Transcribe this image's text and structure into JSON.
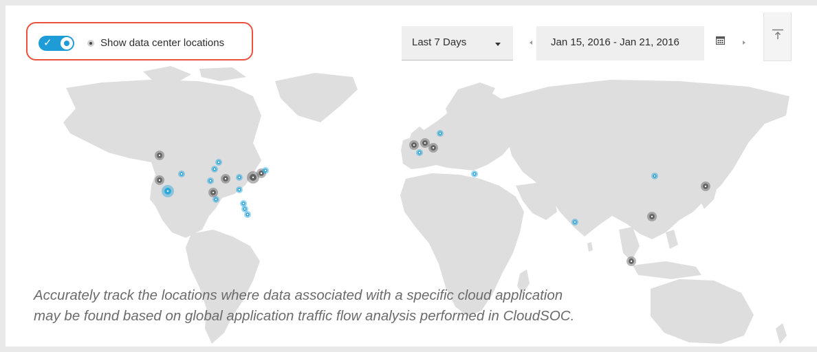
{
  "toolbar": {
    "toggle": {
      "checked": true,
      "check_glyph": "✓",
      "color": "#1e9cd7"
    },
    "legend_label": "Show data center locations",
    "range_select": {
      "selected": "Last 7 Days"
    },
    "date_range": "Jan 15, 2016 - Jan 21, 2016",
    "icons": {
      "prev": "chevron-left-icon",
      "next": "chevron-right-icon",
      "calendar": "calendar-icon",
      "scroll_top": "arrow-up-to-line-icon"
    }
  },
  "map": {
    "land_color": "#dedede",
    "marker_colors": {
      "traffic": "#29a5da",
      "data_center": "#5e5e5e"
    },
    "markers": [
      {
        "region": "Pacific Northwest",
        "type": "data_center",
        "size": "m"
      },
      {
        "region": "Northern California",
        "type": "data_center",
        "size": "m"
      },
      {
        "region": "Southern California",
        "type": "traffic",
        "size": "l"
      },
      {
        "region": "Utah",
        "type": "traffic",
        "size": "s"
      },
      {
        "region": "Great Plains",
        "type": "traffic",
        "size": "s"
      },
      {
        "region": "Great Plains",
        "type": "traffic",
        "size": "s"
      },
      {
        "region": "Midwest",
        "type": "data_center",
        "size": "m"
      },
      {
        "region": "Midwest",
        "type": "traffic",
        "size": "s"
      },
      {
        "region": "Texas",
        "type": "data_center",
        "size": "m"
      },
      {
        "region": "Texas",
        "type": "traffic",
        "size": "s"
      },
      {
        "region": "Ohio Valley",
        "type": "traffic",
        "size": "s"
      },
      {
        "region": "Ohio Valley",
        "type": "traffic",
        "size": "s"
      },
      {
        "region": "Virginia",
        "type": "data_center",
        "size": "l"
      },
      {
        "region": "Northeast",
        "type": "data_center",
        "size": "m"
      },
      {
        "region": "Northeast",
        "type": "traffic",
        "size": "s"
      },
      {
        "region": "Southeast",
        "type": "traffic",
        "size": "s"
      },
      {
        "region": "Florida",
        "type": "traffic",
        "size": "s"
      },
      {
        "region": "Florida",
        "type": "traffic",
        "size": "s"
      },
      {
        "region": "Ireland",
        "type": "data_center",
        "size": "m"
      },
      {
        "region": "United Kingdom",
        "type": "data_center",
        "size": "m"
      },
      {
        "region": "Germany",
        "type": "data_center",
        "size": "m"
      },
      {
        "region": "France",
        "type": "traffic",
        "size": "s"
      },
      {
        "region": "Scandinavia",
        "type": "traffic",
        "size": "s"
      },
      {
        "region": "Turkey",
        "type": "traffic",
        "size": "s"
      },
      {
        "region": "India",
        "type": "traffic",
        "size": "s"
      },
      {
        "region": "Beijing",
        "type": "traffic",
        "size": "s"
      },
      {
        "region": "Tokyo",
        "type": "data_center",
        "size": "m"
      },
      {
        "region": "Hong Kong",
        "type": "data_center",
        "size": "m"
      },
      {
        "region": "Singapore",
        "type": "data_center",
        "size": "m"
      }
    ]
  },
  "caption": {
    "line1": "Accurately track the locations where data associated with a specific cloud application",
    "line2": "may be found based on global application traffic flow analysis performed in CloudSOC."
  }
}
